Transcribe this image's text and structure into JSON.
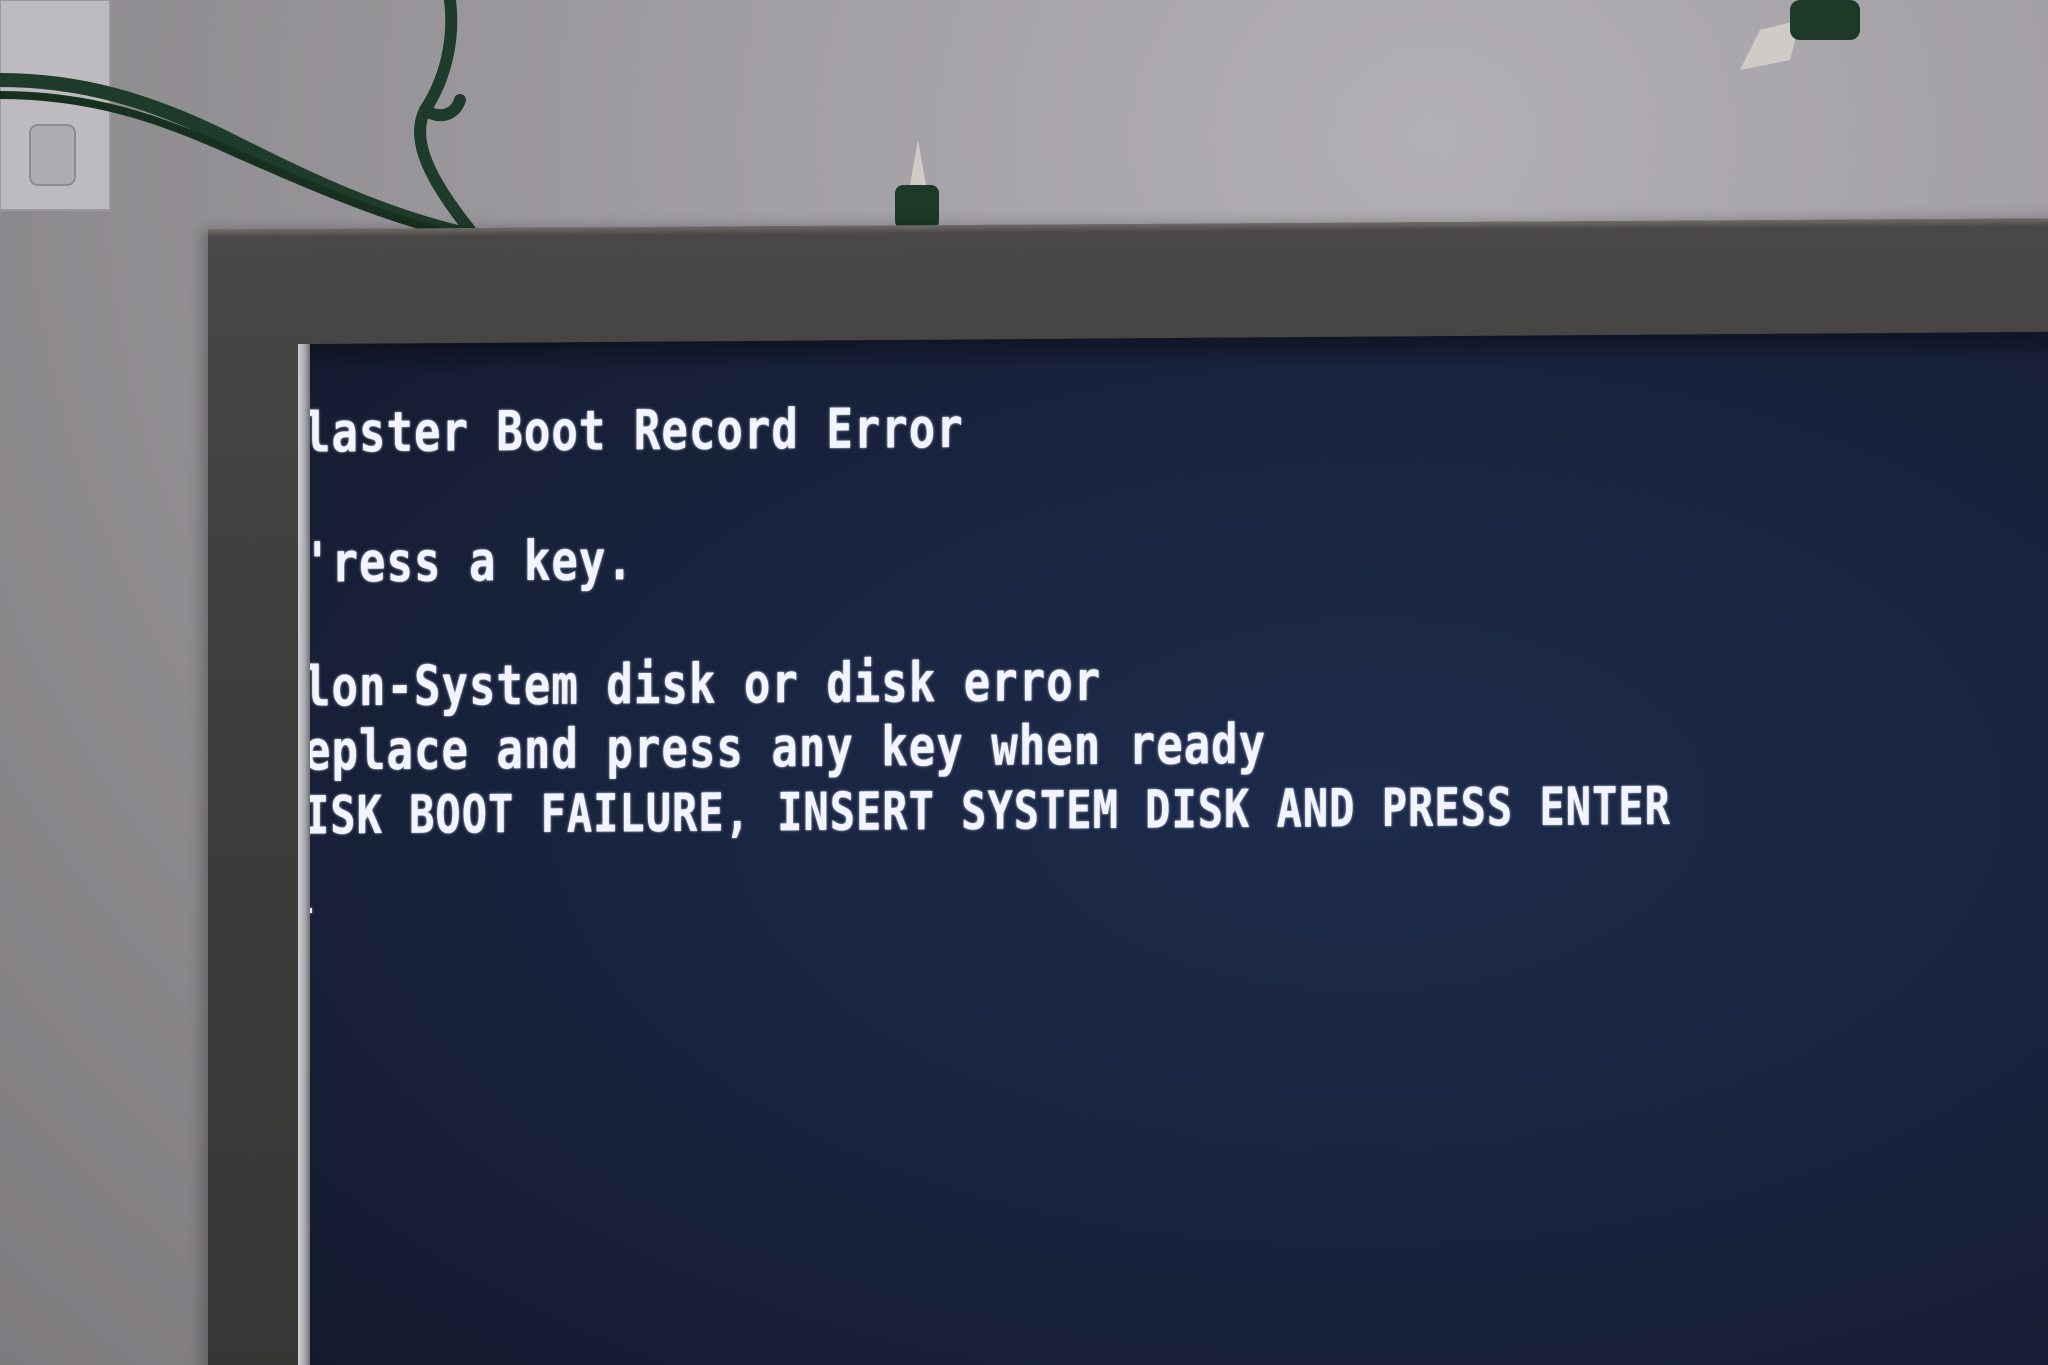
{
  "terminal": {
    "lines": [
      "laster Boot Record Error",
      "'ress a key.",
      "lon-System disk or disk error",
      "eplace and press any key when ready",
      "ISK BOOT FAILURE, INSERT SYSTEM DISK AND PRESS ENTER"
    ],
    "cursor": "_"
  },
  "colors": {
    "screen_background": "#1a2643",
    "text": "#f2f4ff",
    "bezel": "#403e3d",
    "wall": "#a19ea3",
    "cable": "#1f3b2c"
  }
}
